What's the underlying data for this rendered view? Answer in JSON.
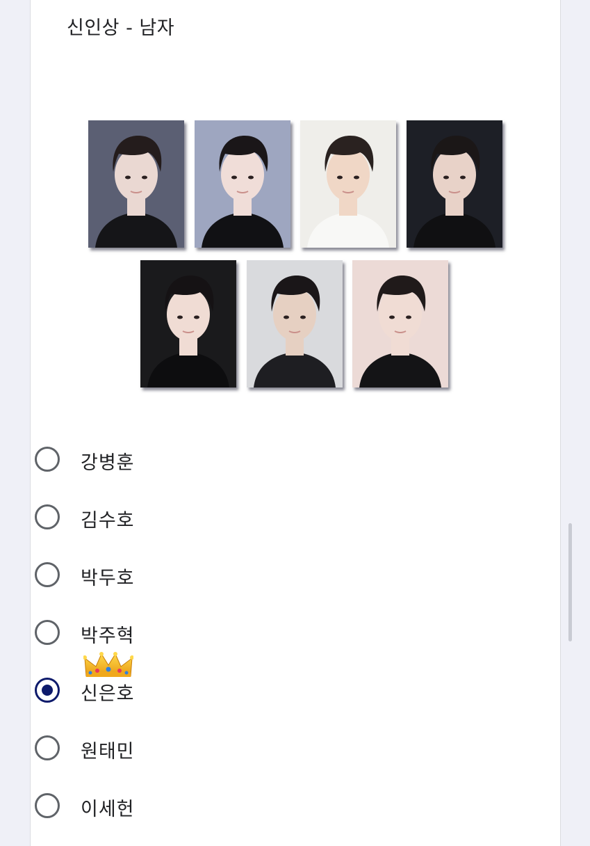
{
  "question": {
    "title": "신인상 - 남자"
  },
  "photos": [
    {
      "bg": "#5b5f73",
      "shirt": "#151518",
      "hair": "#241c1c",
      "skin": "#ead8d2"
    },
    {
      "bg": "#9ea6c0",
      "shirt": "#111114",
      "hair": "#1a1618",
      "skin": "#f0ddd8"
    },
    {
      "bg": "#efeeea",
      "shirt": "#f8f8f6",
      "hair": "#2a2220",
      "skin": "#f0d7c6"
    },
    {
      "bg": "#1d1f26",
      "shirt": "#101012",
      "hair": "#1b1717",
      "skin": "#e8d2c8"
    },
    {
      "bg": "#1a1a1c",
      "shirt": "#0d0d0f",
      "hair": "#151214",
      "skin": "#f0dcd4"
    },
    {
      "bg": "#d9dadd",
      "shirt": "#1e1e22",
      "hair": "#1a1618",
      "skin": "#e6d0c2"
    },
    {
      "bg": "#ecdad6",
      "shirt": "#141416",
      "hair": "#201a1a",
      "skin": "#f0dcd4"
    }
  ],
  "options": [
    {
      "label": "강병훈",
      "selected": false
    },
    {
      "label": "김수호",
      "selected": false
    },
    {
      "label": "박두호",
      "selected": false
    },
    {
      "label": "박주혁",
      "selected": false
    },
    {
      "label": "신은호",
      "selected": true
    },
    {
      "label": "원태민",
      "selected": false
    },
    {
      "label": "이세헌",
      "selected": false
    }
  ],
  "crown_icon": "crown-icon",
  "accent_color": "#0d1a6b"
}
